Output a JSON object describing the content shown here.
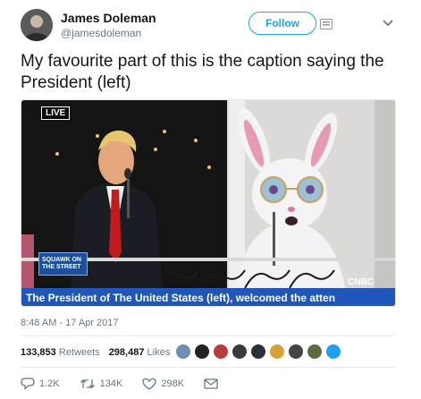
{
  "user": {
    "name": "James Doleman",
    "handle": "@jamesdoleman",
    "follow_label": "Follow"
  },
  "tweet": {
    "text": "My favourite part of this is the caption saying the President (left)",
    "timestamp": "8:48 AM - 17 Apr 2017"
  },
  "media": {
    "live_badge": "LIVE",
    "squawk_line1": "SQUAWK ON",
    "squawk_line2": "THE STREET",
    "network": "CNBC",
    "caption": "The President of The United States (left), welcomed the atten"
  },
  "stats": {
    "retweets_count": "133,853",
    "retweets_label": "Retweets",
    "likes_count": "298,487",
    "likes_label": "Likes"
  },
  "actions": {
    "replies": "1.2K",
    "retweets": "134K",
    "likes": "298K"
  },
  "colors": {
    "accent": "#1da1f2",
    "caption_bar": "#1f56b7",
    "text_muted": "#657786"
  }
}
